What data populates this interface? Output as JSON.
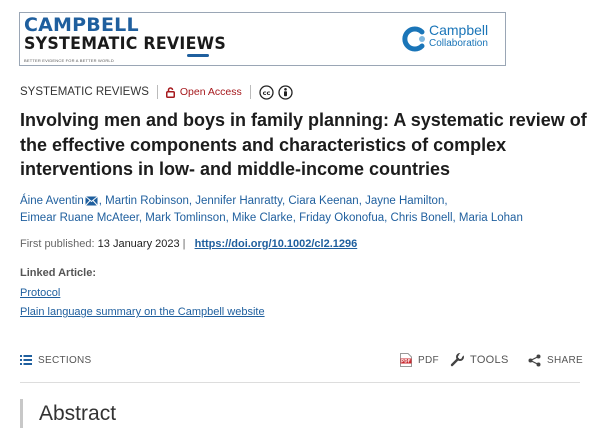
{
  "banner": {
    "journal_line1": "CAMPBELL",
    "journal_line2": "SYSTEMATIC REVIEWS",
    "tagline": "BETTER EVIDENCE FOR A BETTER WORLD",
    "publisher_line1": "Campbell",
    "publisher_line2": "Collaboration"
  },
  "meta": {
    "journal": "SYSTEMATIC REVIEWS",
    "access": "Open Access",
    "license_icons": [
      "creative-commons-icon",
      "attribution-icon"
    ]
  },
  "article": {
    "title": "Involving men and boys in family planning: A systematic review of the effective components and characteristics of complex interventions in low- and middle-income countries",
    "authors": [
      "Áine Aventin",
      "Martin Robinson",
      "Jennifer Hanratty",
      "Ciara Keenan",
      "Jayne Hamilton",
      "Eimear Ruane McAteer",
      "Mark Tomlinson",
      "Mike Clarke",
      "Friday Okonofua",
      "Chris Bonell",
      "Maria Lohan"
    ],
    "published_label": "First published:",
    "published_date": "13 January 2023",
    "doi": "https://doi.org/10.1002/cl2.1296"
  },
  "linked": {
    "heading": "Linked Article:",
    "links": [
      "Protocol",
      "Plain language summary on the Campbell website"
    ]
  },
  "toolbar": {
    "sections": "SECTIONS",
    "pdf": "PDF",
    "tools": "TOOLS",
    "share": "SHARE"
  },
  "abstract_heading": "Abstract",
  "colors": {
    "link": "#1f5f9e",
    "open_access": "#a6191d",
    "journal_blue": "#1f5f9e",
    "campbell_blue": "#1a75b8"
  }
}
